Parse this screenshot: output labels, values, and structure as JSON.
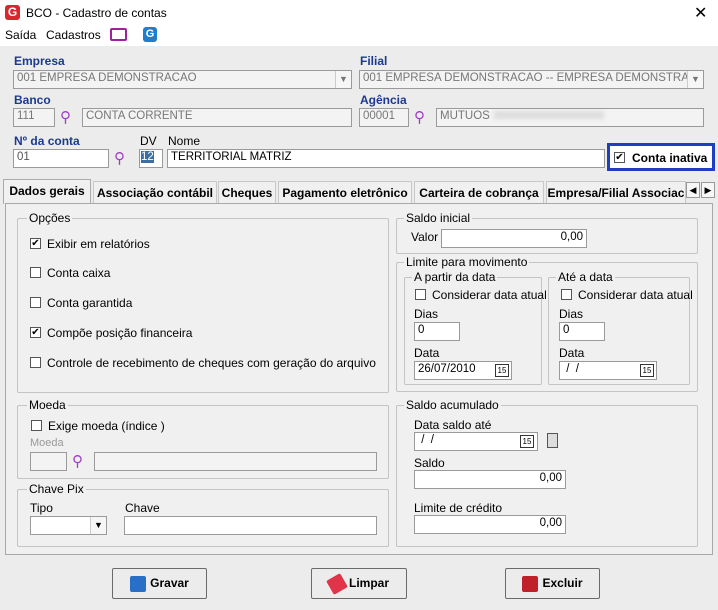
{
  "window": {
    "title": "BCO - Cadastro de contas",
    "app_icon": "G"
  },
  "menu": {
    "items": [
      "Saída",
      "Cadastros"
    ]
  },
  "empresa": {
    "label": "Empresa",
    "value": "001 EMPRESA DEMONSTRACAO"
  },
  "filial": {
    "label": "Filial",
    "value": "001 EMPRESA DEMONSTRACAO -- EMPRESA DEMONSTRACAO"
  },
  "banco": {
    "label": "Banco",
    "code": "111",
    "name": "CONTA CORRENTE"
  },
  "agencia": {
    "label": "Agência",
    "code": "00001",
    "name": "MUTUOS"
  },
  "conta": {
    "label": "Nº da conta",
    "value": "01",
    "dv_label": "DV",
    "dv_value": "12",
    "nome_label": "Nome",
    "nome_value": "TERRITORIAL MATRIZ",
    "inativa_label": "Conta inativa",
    "inativa_checked": true
  },
  "tabs": [
    "Dados gerais",
    "Associação contábil",
    "Cheques",
    "Pagamento eletrônico",
    "Carteira de cobrança",
    "Empresa/Filial Associac"
  ],
  "opcoes": {
    "title": "Opções",
    "items": [
      {
        "label": "Exibir em relatórios",
        "checked": true
      },
      {
        "label": "Conta caixa",
        "checked": false
      },
      {
        "label": "Conta garantida",
        "checked": false
      },
      {
        "label": "Compõe posição financeira",
        "checked": true
      },
      {
        "label": "Controle de recebimento de cheques com geração do arquivo",
        "checked": false
      }
    ]
  },
  "saldo_inicial": {
    "title": "Saldo inicial",
    "valor_label": "Valor",
    "valor": "0,00"
  },
  "limite": {
    "title": "Limite para movimento",
    "a_partir": {
      "title": "A partir da data",
      "considerar": "Considerar data atual",
      "dias_label": "Dias",
      "dias": "0",
      "data_label": "Data",
      "data": "26/07/2010"
    },
    "ate": {
      "title": "Até a data",
      "considerar": "Considerar data atual",
      "dias_label": "Dias",
      "dias": "0",
      "data_label": "Data",
      "data": " /  /"
    }
  },
  "moeda": {
    "title": "Moeda",
    "exige_label": "Exige moeda (índice )",
    "moeda_label": "Moeda"
  },
  "pix": {
    "title": "Chave Pix",
    "tipo_label": "Tipo",
    "chave_label": "Chave"
  },
  "saldo_acum": {
    "title": "Saldo acumulado",
    "data_label": "Data saldo até",
    "data": " /  /",
    "saldo_label": "Saldo",
    "saldo": "0,00",
    "limite_label": "Limite de crédito",
    "limite": "0,00"
  },
  "buttons": {
    "gravar": "Gravar",
    "limpar": "Limpar",
    "excluir": "Excluir"
  },
  "cal_glyph": "15"
}
